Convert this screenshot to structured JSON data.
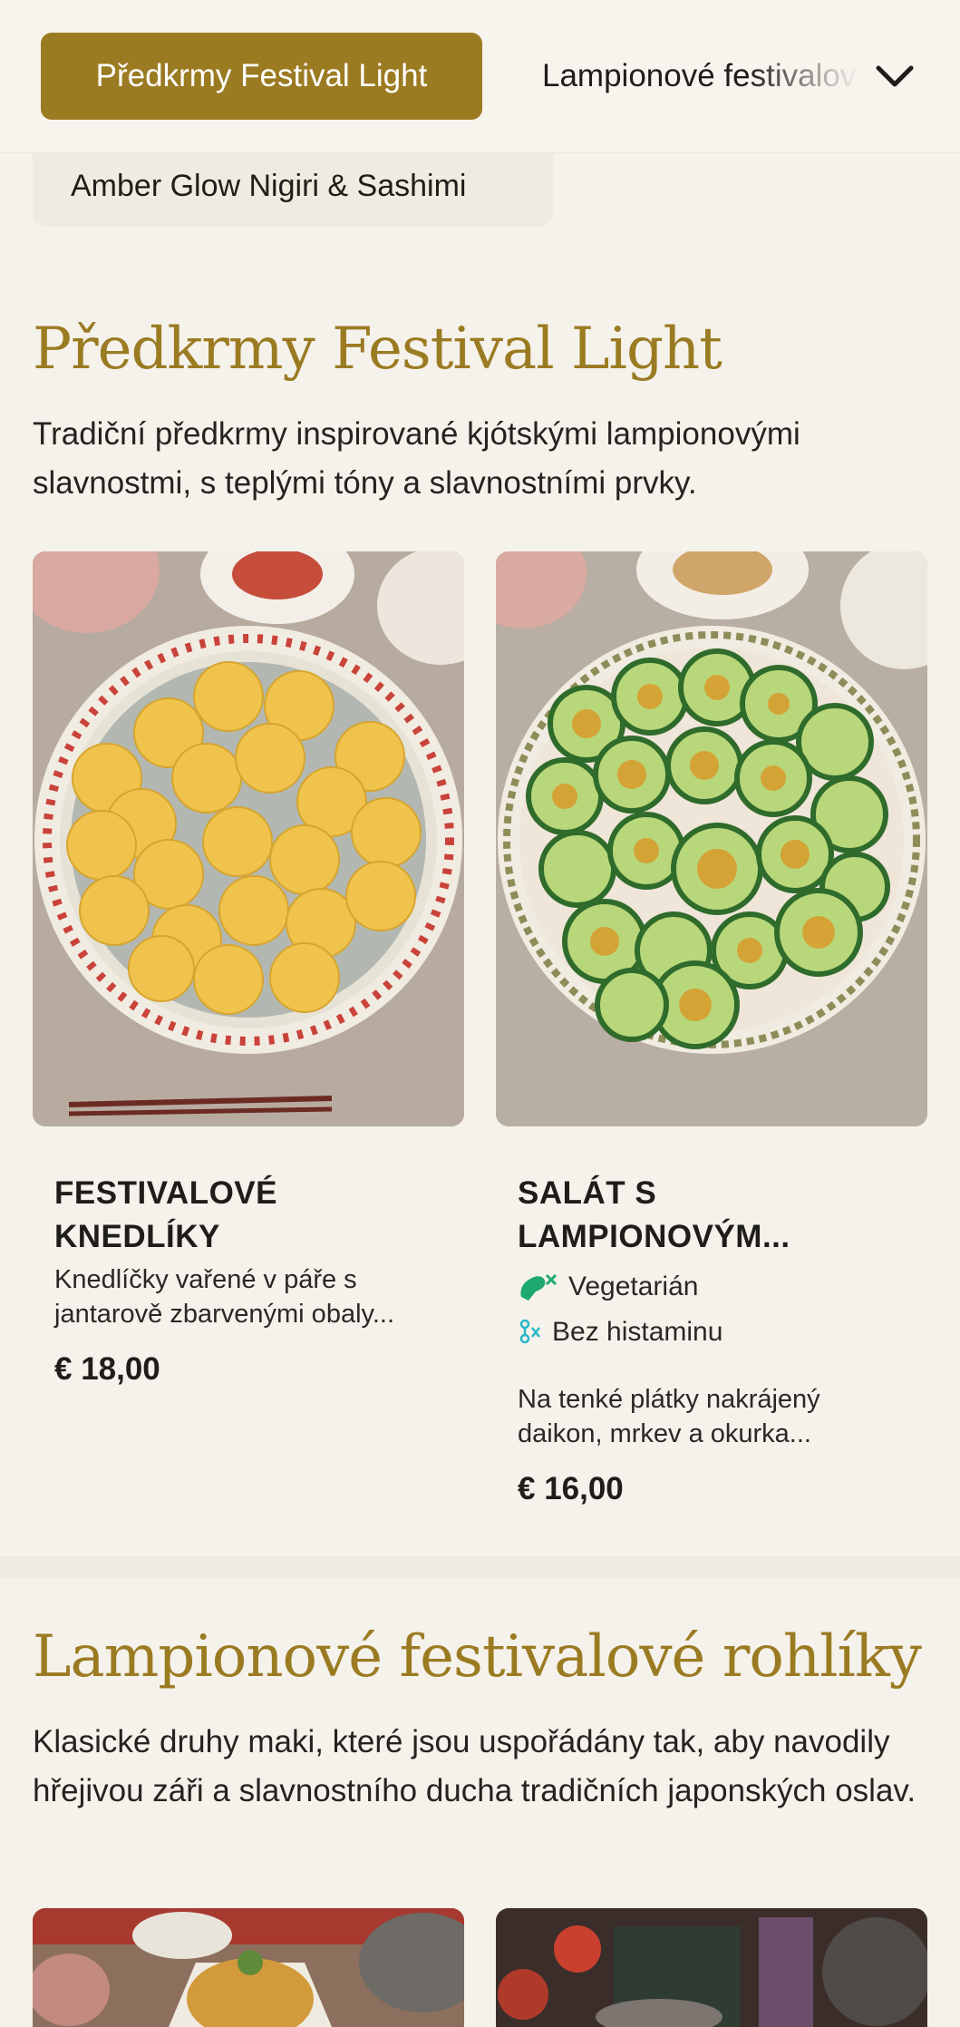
{
  "nav": {
    "active_tab": "Předkrmy Festival Light",
    "next_tab": "Lampionové festivalové rohlíky",
    "subcategory_chip": "Amber Glow Nigiri & Sashimi"
  },
  "sections": [
    {
      "title": "Předkrmy Festival Light",
      "description": "Tradiční předkrmy inspirované kjótskými lampionovými slavnostmi, s teplými tóny a slavnostními prvky.",
      "items": [
        {
          "name": "FESTIVALOVÉ KNEDLÍKY",
          "description": "Knedlíčky vařené v páře s jantarově zbarvenými obaly...",
          "price": "€ 18,00",
          "tags": []
        },
        {
          "name": "SALÁT S LAMPIONOVÝM...",
          "description": "Na tenké plátky nakrájený daikon, mrkev a okurka...",
          "price": "€ 16,00",
          "tags": [
            {
              "label": "Vegetarián",
              "icon": "meat-crossed-icon",
              "color": "#1fa971"
            },
            {
              "label": "Bez histaminu",
              "icon": "histamine-crossed-icon",
              "color": "#27b7c9"
            }
          ]
        }
      ]
    },
    {
      "title": "Lampionové festivalové rohlíky",
      "description": "Klasické druhy maki, které jsou uspořádány tak, aby navodily hřejivou záři a slavnostního ducha tradičních japonských oslav."
    }
  ],
  "colors": {
    "accent": "#9b7b22",
    "background": "#f5f2eb"
  }
}
